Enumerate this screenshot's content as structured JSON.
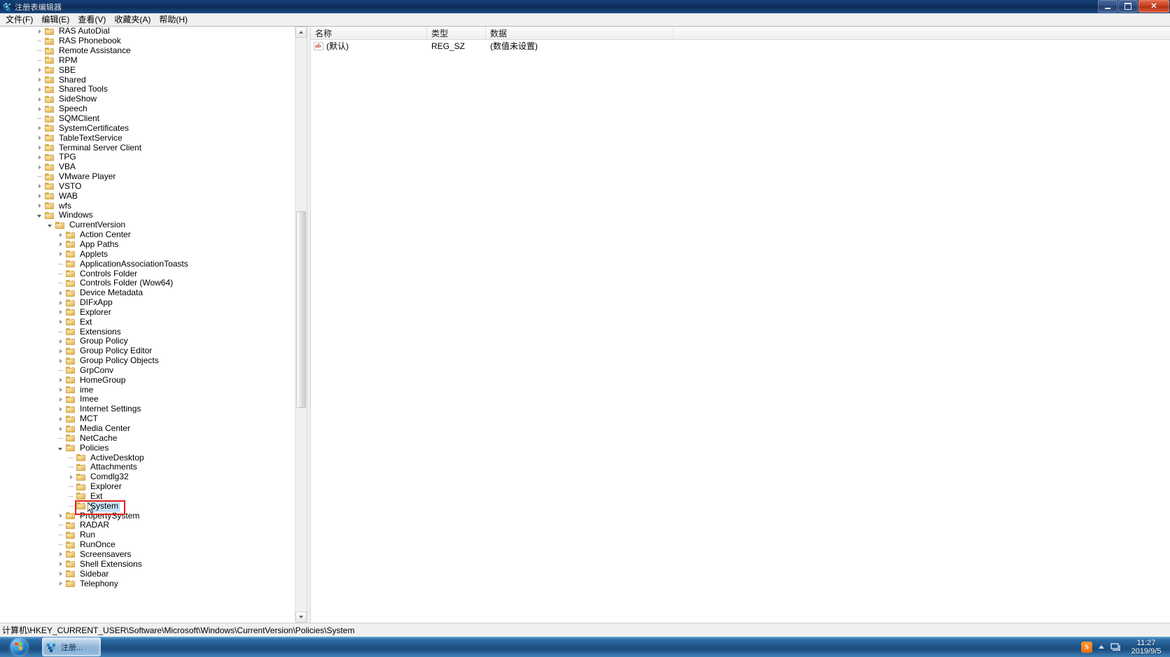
{
  "window": {
    "title": "注册表编辑器",
    "icon": "registry-editor-icon",
    "controls": {
      "minimize": "最小化",
      "maximize": "最大化",
      "close": "关闭"
    }
  },
  "menu": {
    "items": [
      {
        "label": "文件(F)",
        "name": "menu-file"
      },
      {
        "label": "编辑(E)",
        "name": "menu-edit"
      },
      {
        "label": "查看(V)",
        "name": "menu-view"
      },
      {
        "label": "收藏夹(A)",
        "name": "menu-favorites"
      },
      {
        "label": "帮助(H)",
        "name": "menu-help"
      }
    ]
  },
  "tree": {
    "nodes": [
      {
        "label": "RAS AutoDial",
        "indent": 1,
        "state": "collapsed"
      },
      {
        "label": "RAS Phonebook",
        "indent": 1,
        "state": "leaf"
      },
      {
        "label": "Remote Assistance",
        "indent": 1,
        "state": "leaf"
      },
      {
        "label": "RPM",
        "indent": 1,
        "state": "leaf"
      },
      {
        "label": "SBE",
        "indent": 1,
        "state": "collapsed"
      },
      {
        "label": "Shared",
        "indent": 1,
        "state": "collapsed"
      },
      {
        "label": "Shared Tools",
        "indent": 1,
        "state": "collapsed"
      },
      {
        "label": "SideShow",
        "indent": 1,
        "state": "collapsed"
      },
      {
        "label": "Speech",
        "indent": 1,
        "state": "collapsed"
      },
      {
        "label": "SQMClient",
        "indent": 1,
        "state": "leaf"
      },
      {
        "label": "SystemCertificates",
        "indent": 1,
        "state": "collapsed"
      },
      {
        "label": "TableTextService",
        "indent": 1,
        "state": "collapsed"
      },
      {
        "label": "Terminal Server Client",
        "indent": 1,
        "state": "collapsed"
      },
      {
        "label": "TPG",
        "indent": 1,
        "state": "collapsed"
      },
      {
        "label": "VBA",
        "indent": 1,
        "state": "collapsed"
      },
      {
        "label": "VMware Player",
        "indent": 1,
        "state": "leaf"
      },
      {
        "label": "VSTO",
        "indent": 1,
        "state": "collapsed"
      },
      {
        "label": "WAB",
        "indent": 1,
        "state": "collapsed"
      },
      {
        "label": "wfs",
        "indent": 1,
        "state": "collapsed"
      },
      {
        "label": "Windows",
        "indent": 1,
        "state": "expanded"
      },
      {
        "label": "CurrentVersion",
        "indent": 2,
        "state": "expanded"
      },
      {
        "label": "Action Center",
        "indent": 3,
        "state": "collapsed"
      },
      {
        "label": "App Paths",
        "indent": 3,
        "state": "collapsed"
      },
      {
        "label": "Applets",
        "indent": 3,
        "state": "collapsed"
      },
      {
        "label": "ApplicationAssociationToasts",
        "indent": 3,
        "state": "leaf"
      },
      {
        "label": "Controls Folder",
        "indent": 3,
        "state": "leaf"
      },
      {
        "label": "Controls Folder (Wow64)",
        "indent": 3,
        "state": "leaf"
      },
      {
        "label": "Device Metadata",
        "indent": 3,
        "state": "collapsed"
      },
      {
        "label": "DIFxApp",
        "indent": 3,
        "state": "collapsed"
      },
      {
        "label": "Explorer",
        "indent": 3,
        "state": "collapsed"
      },
      {
        "label": "Ext",
        "indent": 3,
        "state": "collapsed"
      },
      {
        "label": "Extensions",
        "indent": 3,
        "state": "leaf"
      },
      {
        "label": "Group Policy",
        "indent": 3,
        "state": "collapsed"
      },
      {
        "label": "Group Policy Editor",
        "indent": 3,
        "state": "collapsed"
      },
      {
        "label": "Group Policy Objects",
        "indent": 3,
        "state": "collapsed"
      },
      {
        "label": "GrpConv",
        "indent": 3,
        "state": "leaf"
      },
      {
        "label": "HomeGroup",
        "indent": 3,
        "state": "collapsed"
      },
      {
        "label": "ime",
        "indent": 3,
        "state": "collapsed"
      },
      {
        "label": "Imee",
        "indent": 3,
        "state": "collapsed"
      },
      {
        "label": "Internet Settings",
        "indent": 3,
        "state": "collapsed"
      },
      {
        "label": "MCT",
        "indent": 3,
        "state": "collapsed"
      },
      {
        "label": "Media Center",
        "indent": 3,
        "state": "collapsed"
      },
      {
        "label": "NetCache",
        "indent": 3,
        "state": "leaf"
      },
      {
        "label": "Policies",
        "indent": 3,
        "state": "expanded"
      },
      {
        "label": "ActiveDesktop",
        "indent": 4,
        "state": "leaf"
      },
      {
        "label": "Attachments",
        "indent": 4,
        "state": "leaf"
      },
      {
        "label": "Comdlg32",
        "indent": 4,
        "state": "collapsed"
      },
      {
        "label": "Explorer",
        "indent": 4,
        "state": "leaf"
      },
      {
        "label": "Ext",
        "indent": 4,
        "state": "leaf"
      },
      {
        "label": "System",
        "indent": 4,
        "state": "leaf",
        "selected": true,
        "highlighted": true
      },
      {
        "label": "PropertySystem",
        "indent": 3,
        "state": "collapsed"
      },
      {
        "label": "RADAR",
        "indent": 3,
        "state": "leaf"
      },
      {
        "label": "Run",
        "indent": 3,
        "state": "leaf"
      },
      {
        "label": "RunOnce",
        "indent": 3,
        "state": "leaf"
      },
      {
        "label": "Screensavers",
        "indent": 3,
        "state": "collapsed"
      },
      {
        "label": "Shell Extensions",
        "indent": 3,
        "state": "collapsed"
      },
      {
        "label": "Sidebar",
        "indent": 3,
        "state": "collapsed"
      },
      {
        "label": "Telephony",
        "indent": 3,
        "state": "collapsed"
      }
    ]
  },
  "list": {
    "columns": [
      {
        "label": "名称",
        "name": "column-name"
      },
      {
        "label": "类型",
        "name": "column-type"
      },
      {
        "label": "数据",
        "name": "column-data"
      }
    ],
    "rows": [
      {
        "name": "(默认)",
        "type": "REG_SZ",
        "data": "(数值未设置)",
        "icon": "string-value-icon"
      }
    ]
  },
  "status": {
    "path": "计算机\\HKEY_CURRENT_USER\\Software\\Microsoft\\Windows\\CurrentVersion\\Policies\\System"
  },
  "taskbar": {
    "start_label": "开始",
    "items": [
      {
        "label": "注册...",
        "name": "taskbar-item-regedit"
      }
    ],
    "tray": {
      "sogou_label": "S",
      "chevron": "show-hidden-icons",
      "network": "network-icon",
      "time": "11:27",
      "date": "2019/9/5"
    }
  },
  "colors": {
    "selection": "#cce8ff",
    "annotation": "#e8201a",
    "title_gradient_start": "#15407c",
    "taskbar": "#1c5186"
  }
}
